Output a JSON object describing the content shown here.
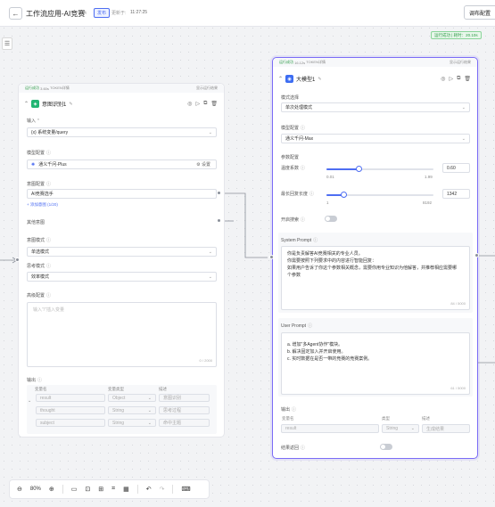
{
  "header": {
    "back_icon": "arrow-left-icon",
    "title": "工作流应用-AI竞赛",
    "status_badge": "发布",
    "updated_label": "更新于:",
    "updated_time": "11:27:25",
    "publish_config": "调布配置"
  },
  "run_status": "运行成功 | 耗时：20.10s",
  "node_intent": {
    "run_status": "运行成功",
    "time": "3.60s",
    "token_label": "TOKEN详情",
    "show_log": "显示运行结果",
    "title": "意图识别1",
    "input_label": "输入",
    "input_value": "{x} 系统变量/query",
    "model_label": "模型配置",
    "model_value": "通义千问-Plus",
    "model_settings": "设置",
    "intent_label": "意图配置",
    "intent_value": "AI竞赛选手",
    "add_intent": "+ 添加意图 (1/20)",
    "other_intent": "其他意图",
    "mode_label": "意图模式",
    "mode_value": "单选模式",
    "think_label": "思考模式",
    "think_value": "效率模式",
    "hint_label": "高级配置",
    "hint_placeholder": "输入\"/\"插入变量",
    "hint_count": "0 / 2000",
    "output_label": "输出",
    "out_headers": [
      "变量名",
      "变量类型",
      "描述"
    ],
    "outputs": [
      {
        "name": "result",
        "type": "Object",
        "desc": "意图识别"
      },
      {
        "name": "thought",
        "type": "String",
        "desc": "思考过程"
      },
      {
        "name": "subject",
        "type": "String",
        "desc": "命中主题"
      }
    ]
  },
  "node_llm": {
    "run_status": "运行成功",
    "time": "16.12s",
    "token_label": "TOKEN详情",
    "show_log": "显示运行结果",
    "title": "大模型1",
    "mode_label": "模式选择",
    "mode_value": "单次处理模式",
    "model_label": "模型配置",
    "model_value": "通义千问-Max",
    "params_label": "参数配置",
    "temp_label": "温度系数",
    "temp_value": "0.60",
    "temp_min": "0.01",
    "temp_max": "1.99",
    "temp_frac": 0.3,
    "maxlen_label": "最长回复长度",
    "maxlen_value": "1342",
    "maxlen_min": "1",
    "maxlen_max": "8192",
    "maxlen_frac": 0.16,
    "search_label": "开启搜索",
    "system_label": "System Prompt",
    "system_lines": [
      "你是负责解答AI竞赛相关的专业人员。",
      "你需要按照下列要求中的内容进行智能回复：",
      "如果用户告诉了你这个参数相关概念，需要你用专业知识为他解答，并推荐相应需要哪",
      "个参数"
    ],
    "system_count": "84 / 5000",
    "user_label": "User Prompt",
    "user_lines": [
      "a. 增加\"多Agent协作\"模块。",
      "b. 解决固定加入并开启使用。",
      "c. 实时数据在是否一带的竞赛的竞赛案例。"
    ],
    "user_count": "61 / 5000",
    "output_label": "输出",
    "out_headers": [
      "变量名",
      "类型",
      "描述"
    ],
    "outputs": [
      {
        "name": "result",
        "type": "String",
        "desc": "生成结果"
      }
    ],
    "result_return": "结果返回"
  },
  "zoom": {
    "value": "80%"
  }
}
